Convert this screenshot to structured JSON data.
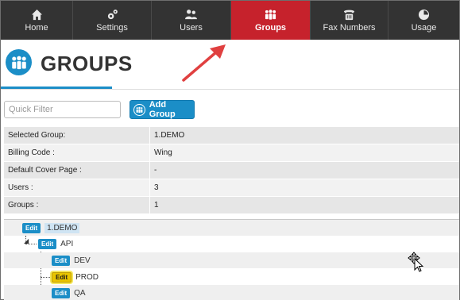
{
  "nav": {
    "items": [
      {
        "label": "Home",
        "icon": "home-icon"
      },
      {
        "label": "Settings",
        "icon": "settings-icon"
      },
      {
        "label": "Users",
        "icon": "users-icon"
      },
      {
        "label": "Groups",
        "icon": "groups-icon",
        "active": true
      },
      {
        "label": "Fax Numbers",
        "icon": "fax-icon"
      },
      {
        "label": "Usage",
        "icon": "pie-chart-icon"
      }
    ]
  },
  "page": {
    "title": "GROUPS"
  },
  "filter": {
    "placeholder": "Quick Filter"
  },
  "add_group": {
    "label": "Add Group"
  },
  "info": {
    "rows": [
      {
        "label": "Selected Group:",
        "value": "1.DEMO"
      },
      {
        "label": "Billing Code :",
        "value": "Wing"
      },
      {
        "label": "Default Cover Page :",
        "value": "-"
      },
      {
        "label": "Users :",
        "value": "3"
      },
      {
        "label": "Groups :",
        "value": "1"
      }
    ]
  },
  "tree": {
    "edit_label": "Edit",
    "nodes": [
      {
        "label": "1.DEMO",
        "level": 0,
        "selected": true
      },
      {
        "label": "API",
        "level": 1
      },
      {
        "label": "DEV",
        "level": 2
      },
      {
        "label": "PROD",
        "level": 2,
        "highlighted": true
      },
      {
        "label": "QA",
        "level": 2
      }
    ]
  },
  "colors": {
    "nav_bg": "#333333",
    "nav_active": "#c6222c",
    "accent": "#1b8ec7",
    "highlight": "#e8c400",
    "annotation_arrow": "#e04040"
  }
}
